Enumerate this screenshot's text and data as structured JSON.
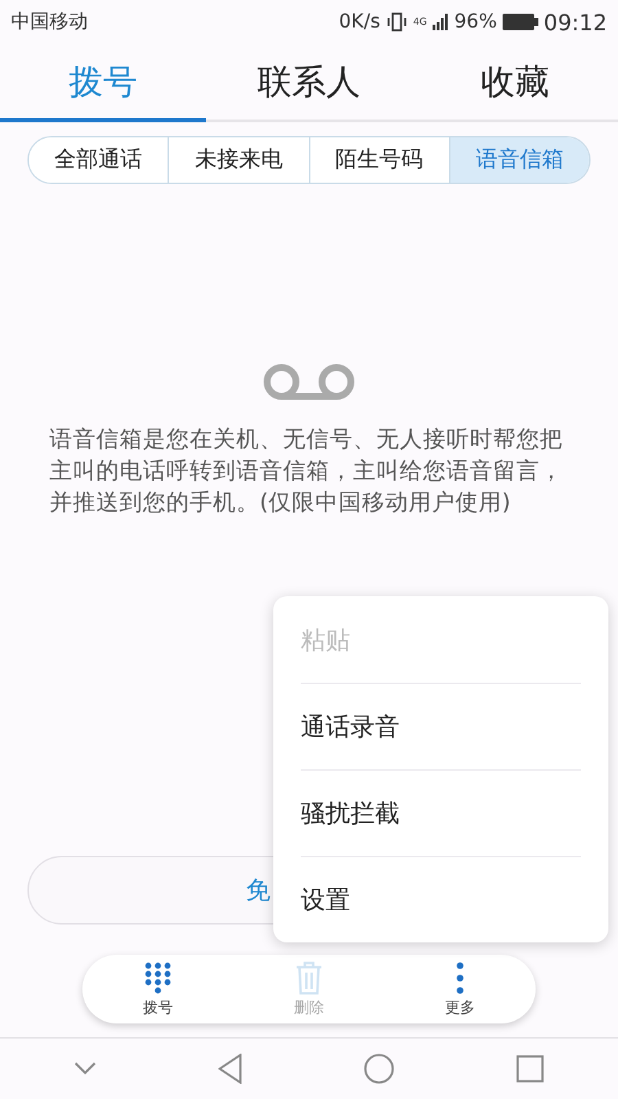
{
  "status_bar": {
    "carrier": "中国移动",
    "speed": "0K/s",
    "network": "4G",
    "battery": "96%",
    "time": "09:12"
  },
  "tabs": [
    {
      "label": "拨号",
      "selected": true
    },
    {
      "label": "联系人",
      "selected": false
    },
    {
      "label": "收藏",
      "selected": false
    }
  ],
  "filters": [
    {
      "label": "全部通话",
      "selected": false
    },
    {
      "label": "未接来电",
      "selected": false
    },
    {
      "label": "陌生号码",
      "selected": false
    },
    {
      "label": "语音信箱",
      "selected": true
    }
  ],
  "voicemail": {
    "description": "语音信箱是您在关机、无信号、无人接听时帮您把主叫的电话呼转到语音信箱，主叫给您语音留言，并推送到您的手机。(仅限中国移动用户使用)",
    "button": "免"
  },
  "toolbar": [
    {
      "kind": "dialpad",
      "label": "拨号",
      "disabled": false
    },
    {
      "kind": "delete",
      "label": "删除",
      "disabled": true
    },
    {
      "kind": "more",
      "label": "更多",
      "disabled": false
    }
  ],
  "menu": [
    {
      "label": "粘贴",
      "disabled": true
    },
    {
      "label": "通话录音",
      "disabled": false
    },
    {
      "label": "骚扰拦截",
      "disabled": false
    },
    {
      "label": "设置",
      "disabled": false
    }
  ]
}
